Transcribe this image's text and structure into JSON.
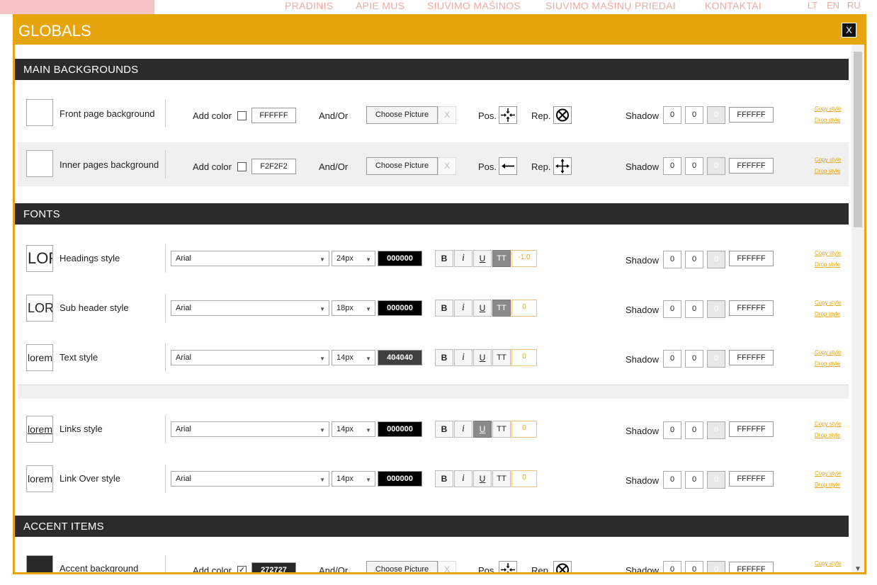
{
  "background_nav": {
    "items": [
      "PRADINIS",
      "APIE MUS",
      "SIUVIMO MAŠINOS",
      "SIUVIMO MAŠINŲ PRIEDAI",
      "KONTAKTAI"
    ],
    "langs": [
      "LT",
      "EN",
      "RU"
    ]
  },
  "modal": {
    "title": "GLOBALS",
    "close_label": "X",
    "accent_color": "#e6a50d"
  },
  "common": {
    "add_color": "Add color",
    "and_or": "And/Or",
    "choose_picture": "Choose Picture",
    "remove": "X",
    "pos": "Pos.",
    "rep": "Rep.",
    "shadow": "Shadow",
    "copy_style": "Copy style",
    "drop_style": "Drop style",
    "btn_bold": "B",
    "btn_italic": "i",
    "btn_underline": "U",
    "btn_caps": "TT"
  },
  "sections": {
    "main_backgrounds": "MAIN BACKGROUNDS",
    "fonts": "FONTS",
    "accent_items": "ACCENT ITEMS"
  },
  "backgrounds": [
    {
      "label": "Front page background",
      "checked": false,
      "color": "FFFFFF",
      "shadow": [
        "0",
        "0",
        "0"
      ],
      "shadow_color": "FFFFFF",
      "pos_icon": "arrows-in-icon",
      "rep_icon": "no-repeat-icon"
    },
    {
      "label": "Inner pages background",
      "checked": false,
      "color": "F2F2F2",
      "shadow": [
        "0",
        "0",
        "0"
      ],
      "shadow_color": "FFFFFF",
      "pos_icon": "arrow-left-icon",
      "rep_icon": "arrows-out-icon"
    }
  ],
  "fonts": [
    {
      "label": "Headings style",
      "preview": "LOREM",
      "font": "Arial",
      "size": "24px",
      "color": "000000",
      "spacing": "-1.0",
      "active": [
        "caps"
      ],
      "shadow": [
        "0",
        "0",
        "0"
      ],
      "shadow_color": "FFFFFF"
    },
    {
      "label": "Sub header style",
      "preview": "LOREM",
      "font": "Arial",
      "size": "18px",
      "color": "000000",
      "spacing": "0",
      "active": [
        "caps"
      ],
      "shadow": [
        "0",
        "0",
        "0"
      ],
      "shadow_color": "FFFFFF"
    },
    {
      "label": "Text style",
      "preview": "lorem",
      "font": "Arial",
      "size": "14px",
      "color": "404040",
      "spacing": "0",
      "active": [],
      "shadow": [
        "0",
        "0",
        "0"
      ],
      "shadow_color": "FFFFFF"
    },
    {
      "label": "Links style",
      "preview": "lorem",
      "font": "Arial",
      "size": "14px",
      "color": "000000",
      "spacing": "0",
      "active": [
        "underline"
      ],
      "shadow": [
        "0",
        "0",
        "0"
      ],
      "shadow_color": "FFFFFF"
    },
    {
      "label": "Link Over style",
      "preview": "lorem",
      "font": "Arial",
      "size": "14px",
      "color": "000000",
      "spacing": "0",
      "active": [],
      "shadow": [
        "0",
        "0",
        "0"
      ],
      "shadow_color": "FFFFFF"
    }
  ],
  "accent": {
    "label": "Accent background",
    "checked": true,
    "color": "272727",
    "shadow": [
      "0",
      "0",
      "0"
    ],
    "shadow_color": "FFFFFF"
  }
}
